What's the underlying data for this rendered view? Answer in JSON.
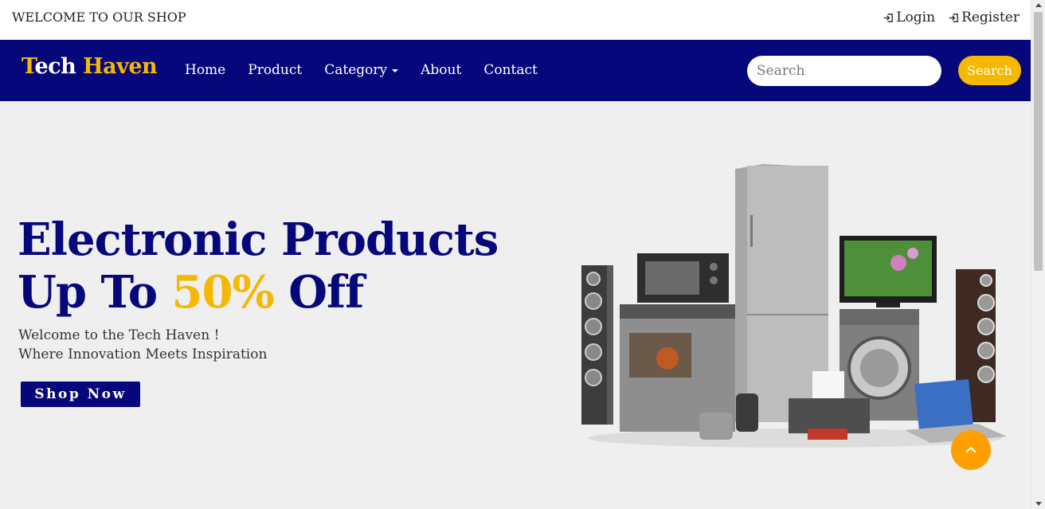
{
  "topbar": {
    "welcome": "WELCOME TO OUR SHOP",
    "login": "Login",
    "register": "Register"
  },
  "nav": {
    "brand_parts": [
      "T",
      "ech ",
      "Haven"
    ],
    "menu": [
      "Home",
      "Product",
      "Category",
      "About",
      "Contact"
    ],
    "search_placeholder": "Search",
    "search_button": "Search"
  },
  "hero": {
    "line1": "Electronic Products",
    "line2_a": "Up To ",
    "line2_pct": "50%",
    "line2_b": " Off",
    "sub1": "Welcome to the Tech Haven !",
    "sub2": "Where Innovation Meets Inspiration",
    "cta": "Shop Now"
  },
  "colors": {
    "primary": "#06077a",
    "accent": "#f5b800",
    "back_to_top": "#ff9f00",
    "background": "#efefef"
  },
  "icons": {
    "login": "login-icon",
    "register": "register-icon",
    "back_to_top": "chevron-up-icon"
  }
}
